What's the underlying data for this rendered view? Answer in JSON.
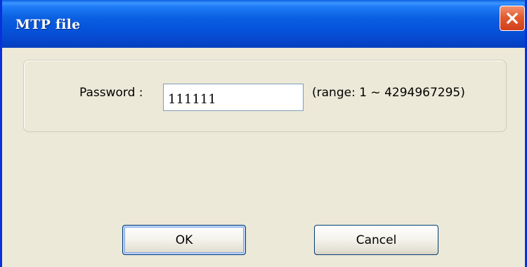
{
  "window": {
    "title": "MTP file"
  },
  "form": {
    "password_label": "Password :",
    "password_value": "111111",
    "range_hint": "(range: 1 ~ 4294967295)"
  },
  "buttons": {
    "ok_label": "OK",
    "cancel_label": "Cancel"
  },
  "icons": {
    "close": "close-icon"
  },
  "colors": {
    "titlebar_blue": "#0a5fe0",
    "close_red": "#e25b2f",
    "dialog_bg": "#ece9d8"
  }
}
